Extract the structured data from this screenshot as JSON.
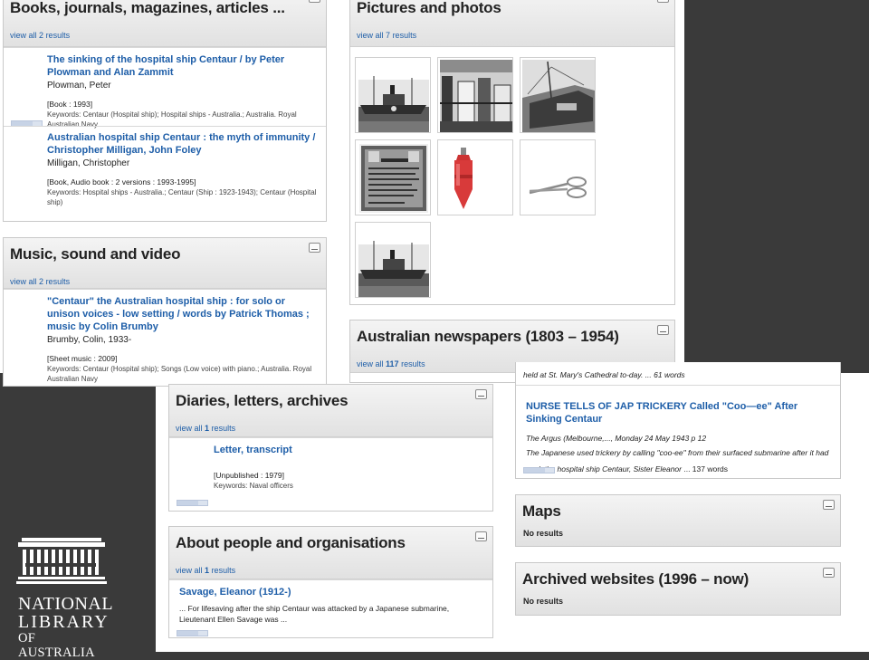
{
  "books": {
    "title": "Books, journals, magazines, articles ...",
    "view_all_prefix": "view all",
    "view_all_count": "2",
    "view_all_suffix": "results",
    "records": [
      {
        "title": "The sinking of the hospital ship Centaur / by Peter Plowman and Alan Zammit",
        "author": "Plowman, Peter",
        "format": "[Book : 1993]",
        "keywords": "Keywords: Centaur (Hospital ship); Hospital ships - Australia.; Australia. Royal Australian Navy"
      },
      {
        "title": "Australian hospital ship Centaur : the myth of immunity / Christopher Milligan, John Foley",
        "author": "Milligan, Christopher",
        "format": "[Book, Audio book : 2 versions : 1993-1995]",
        "keywords": "Keywords: Hospital ships - Australia.; Centaur (Ship : 1923-1943); Centaur (Hospital ship)"
      }
    ]
  },
  "music": {
    "title": "Music, sound and video",
    "view_all_prefix": "view all",
    "view_all_count": "2",
    "view_all_suffix": "results",
    "records": [
      {
        "title": "\"Centaur\" the Australian hospital ship : for solo or unison voices - low setting / words by Patrick Thomas ; music by Colin Brumby",
        "author": "Brumby, Colin, 1933-",
        "format": "[Sheet music : 2009]",
        "keywords": "Keywords: Centaur (Hospital ship); Songs (Low voice) with piano.; Australia. Royal Australian Navy"
      }
    ]
  },
  "pictures": {
    "title": "Pictures and photos",
    "view_all_prefix": "view all",
    "view_all_count": "7",
    "view_all_suffix": "results",
    "thumbs": [
      "ship-photo",
      "interior-photo",
      "ship-bow-photo",
      "centaur-park-plaque",
      "red-buoy",
      "scissors",
      "ship-photo-2"
    ]
  },
  "newspapers": {
    "title": "Australian newspapers (1803 – 1954)",
    "view_all_prefix": "view all",
    "view_all_count": "117",
    "view_all_suffix": "results",
    "cut_line": "held at St. Mary's Cathedral to-day. ... 61 words",
    "records": [
      {
        "title": "NURSE TELLS OF JAP TRICKERY Called \"Coo—ee\" After Sinking Centaur",
        "source": "The Argus (Melbourne,..., Monday 24 May 1943 p 12",
        "snippet_italic": "The Japanese used trickery by calling \"coo-ee\" from their surfaced submarine after it had sunk the hospital ship Centaur, Sister Eleanor",
        "snippet_plain": " ... 137 words"
      }
    ]
  },
  "diaries": {
    "title": "Diaries, letters, archives",
    "view_all_prefix": "view all",
    "view_all_count": "1",
    "view_all_suffix": "results",
    "records": [
      {
        "title": "Letter, transcript",
        "format": "[Unpublished : 1979]",
        "keywords": "Keywords: Naval officers"
      }
    ]
  },
  "people": {
    "title": "About people and organisations",
    "view_all_prefix": "view all",
    "view_all_count": "1",
    "view_all_suffix": "results",
    "records": [
      {
        "title": "Savage, Eleanor (1912-)",
        "snippet": "... For lifesaving after the ship Centaur was attacked by a Japanese submarine, Lieutenant Ellen Savage was ..."
      }
    ]
  },
  "maps": {
    "title": "Maps",
    "no_results": "No results"
  },
  "archived": {
    "title": "Archived websites (1996 – now)",
    "no_results": "No results"
  },
  "logo": {
    "line1": "NATIONAL",
    "line2": "LIBRARY",
    "line3": "OF AUSTRALIA"
  },
  "colors": {
    "link": "#1e5ea8",
    "background": "#3a3a3a"
  }
}
